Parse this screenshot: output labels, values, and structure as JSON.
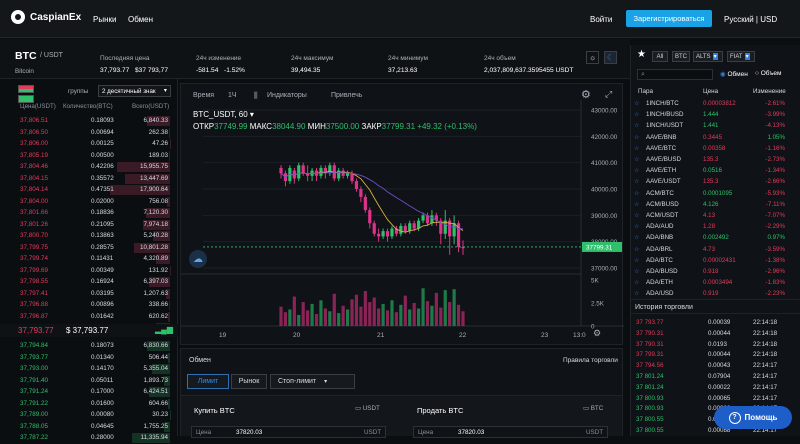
{
  "nav": {
    "brand": "CaspianEx",
    "markets": "Рынки",
    "exchange": "Обмен",
    "login": "Войти",
    "register": "Зарегистрироваться",
    "lang": "Русский | USD"
  },
  "ticker": {
    "pair": "BTC",
    "quote": "/ USDT",
    "name": "Bitcoin",
    "last_price_label": "Последняя цена",
    "last_price": "37,793.77",
    "last_price_usd": "$37 793,77",
    "change_label": "24ч изменение",
    "change": "-581.54",
    "change_pct": "-1.52%",
    "high_label": "24ч максимум",
    "high": "39,494.35",
    "low_label": "24ч минимум",
    "low": "37,213.63",
    "volume_label": "24ч объем",
    "volume": "2,037,809,637.3595455 USDT"
  },
  "orderbook": {
    "groups_label": "группы",
    "decimals": "2 десятичный знак",
    "col_price": "Цена(USDT)",
    "col_qty": "Количество(BTC)",
    "col_total": "Всего(USDT)",
    "asks": [
      [
        "37,806.51",
        "0.18093",
        "6,840.33"
      ],
      [
        "37,806.50",
        "0.00694",
        "262.38"
      ],
      [
        "37,806.00",
        "0.00125",
        "47.26"
      ],
      [
        "37,805.19",
        "0.00500",
        "189.03"
      ],
      [
        "37,804.46",
        "0.42206",
        "15,955.75"
      ],
      [
        "37,804.15",
        "0.35572",
        "13,447.69"
      ],
      [
        "37,804.14",
        "0.47351",
        "17,900.64"
      ],
      [
        "37,804.00",
        "0.02000",
        "756.08"
      ],
      [
        "37,801.66",
        "0.18836",
        "7,120.30"
      ],
      [
        "37,801.26",
        "0.21095",
        "7,974.18"
      ],
      [
        "37,800.70",
        "0.13863",
        "5,240.28"
      ],
      [
        "37,799.75",
        "0.28575",
        "10,801.28"
      ],
      [
        "37,799.74",
        "0.11431",
        "4,320.89"
      ],
      [
        "37,799.69",
        "0.00349",
        "131.92"
      ],
      [
        "37,798.55",
        "0.16924",
        "6,397.03"
      ],
      [
        "37,797.41",
        "0.03195",
        "1,207.63"
      ],
      [
        "37,796.88",
        "0.00896",
        "338.66"
      ],
      [
        "37,796.87",
        "0.01642",
        "620.62"
      ],
      [
        "37,794.85",
        "0.11013",
        "4,162.55"
      ]
    ],
    "mid_price": "37,793.77",
    "mid_usd": "$ 37,793.77",
    "bids": [
      [
        "37,794.84",
        "0.18073",
        "6,830.66"
      ],
      [
        "37,793.77",
        "0.01340",
        "506.44"
      ],
      [
        "37,793.00",
        "0.14170",
        "5,355.04"
      ],
      [
        "37,791.40",
        "0.05011",
        "1,893.73"
      ],
      [
        "37,791.24",
        "0.17000",
        "6,424.51"
      ],
      [
        "37,791.22",
        "0.01600",
        "604.66"
      ],
      [
        "37,789.00",
        "0.00080",
        "30.23"
      ],
      [
        "37,788.05",
        "0.04645",
        "1,755.25"
      ],
      [
        "37,787.22",
        "0.28000",
        "11,335.94"
      ]
    ]
  },
  "chart": {
    "tab_time": "Время",
    "tab_interval": "1Ч",
    "tab_indicators": "Индикаторы",
    "tab_recent": "Привлечь",
    "title": "BTC_USDT, 60",
    "ohlc": "ОТКР37749.99 МАКС38044.90 МИН37500.00 ЗАКР37799.31 +49.32 (+0.13%)",
    "open": "37749.99",
    "high": "38044.90",
    "low": "37500.00",
    "close": "37799.31",
    "change": "+49.32 (+0.13%)",
    "price_ticks": [
      "43000.00",
      "42000.00",
      "41000.00",
      "40000.00",
      "39000.00",
      "38000.00",
      "37000.00"
    ],
    "current_tag": "37799.31",
    "vol_ticks": [
      "5K",
      "2.5K",
      "0"
    ],
    "x_ticks": [
      "19",
      "20",
      "21",
      "22",
      "23",
      "13:0"
    ]
  },
  "chart_data": {
    "type": "candlestick",
    "x_ticks": [
      "19",
      "20",
      "21",
      "22",
      "23"
    ],
    "ylim": [
      37000,
      43000
    ],
    "last": 37799.31,
    "candles": [
      [
        40800,
        40600,
        40900,
        40400
      ],
      [
        40600,
        40300,
        40700,
        40100
      ],
      [
        40300,
        40800,
        40900,
        40200
      ],
      [
        40700,
        40400,
        40800,
        40200
      ],
      [
        40400,
        40900,
        41000,
        40300
      ],
      [
        40900,
        40600,
        41000,
        40500
      ],
      [
        40600,
        40500,
        40900,
        40300
      ],
      [
        40500,
        40700,
        40800,
        40300
      ],
      [
        40700,
        40500,
        40800,
        40300
      ],
      [
        40500,
        40800,
        40900,
        40400
      ],
      [
        40800,
        40600,
        40900,
        40400
      ],
      [
        40600,
        40900,
        41000,
        40500
      ],
      [
        40900,
        40400,
        41000,
        40300
      ],
      [
        40400,
        40700,
        40800,
        40300
      ],
      [
        40700,
        40500,
        40800,
        40400
      ],
      [
        40500,
        40600,
        40700,
        40400
      ],
      [
        40600,
        40300,
        40700,
        40200
      ],
      [
        40300,
        40000,
        40400,
        39900
      ],
      [
        40000,
        39700,
        40100,
        39500
      ],
      [
        39700,
        39200,
        39800,
        39100
      ],
      [
        39200,
        38700,
        39300,
        38500
      ],
      [
        38700,
        38300,
        38800,
        38200
      ],
      [
        38300,
        38200,
        38500,
        38000
      ],
      [
        38200,
        38400,
        38500,
        38100
      ],
      [
        38400,
        38200,
        38500,
        38000
      ],
      [
        38200,
        38500,
        38600,
        38100
      ],
      [
        38500,
        38300,
        38600,
        38200
      ],
      [
        38300,
        38600,
        38700,
        38200
      ],
      [
        38600,
        38400,
        38700,
        38300
      ],
      [
        38400,
        38700,
        38800,
        38300
      ],
      [
        38700,
        38500,
        38800,
        38400
      ],
      [
        38500,
        38800,
        38900,
        38400
      ],
      [
        38800,
        39000,
        39100,
        38700
      ],
      [
        39000,
        38700,
        39100,
        38600
      ],
      [
        38700,
        39000,
        39200,
        38600
      ],
      [
        39000,
        38800,
        39100,
        38600
      ],
      [
        38800,
        38300,
        38900,
        37900
      ],
      [
        38300,
        38800,
        39200,
        38100
      ],
      [
        38800,
        38200,
        38900,
        37500
      ],
      [
        38200,
        38700,
        39000,
        37900
      ],
      [
        38700,
        37800,
        38800,
        37600
      ],
      [
        37800,
        37750,
        38050,
        37500
      ]
    ],
    "volumes": [
      2.1,
      1.5,
      1.8,
      3.2,
      1.2,
      2.6,
      1.7,
      2.4,
      1.3,
      2.8,
      1.9,
      1.6,
      3.5,
      1.4,
      2.2,
      1.8,
      2.9,
      3.4,
      2.1,
      3.8,
      2.6,
      3.1,
      1.9,
      2.4,
      1.7,
      2.8,
      1.5,
      2.3,
      3.3,
      1.8,
      2.5,
      1.9,
      4.1,
      2.7,
      2.2,
      3.6,
      2.0,
      3.9,
      2.6,
      4.0,
      2.3,
      1.6
    ],
    "vol_ylim": [
      0,
      5
    ]
  },
  "trade": {
    "title": "Обмен",
    "rules": "Правила торговли",
    "tab_limit": "Лимит",
    "tab_market": "Рынок",
    "tab_stoplimit": "Стоп-лимит",
    "buy_title": "Купить BTC",
    "sell_title": "Продать BTC",
    "balance_unit_buy": "USDT",
    "balance_unit_sell": "BTC",
    "price_label": "Цена",
    "buy_price": "37820.03",
    "sell_price": "37820.03",
    "price_unit": "USDT"
  },
  "markets": {
    "tabs": [
      "All",
      "BTC",
      "ALTS",
      "FIAT"
    ],
    "radio_exchange": "Обмен",
    "radio_volume": "Объем",
    "search_placeholder": "",
    "col_pair": "Пара",
    "col_price": "Цена",
    "col_change": "Изменение",
    "rows": [
      [
        "1INCH/BTC",
        "0.00003812",
        "-2.61%",
        "red"
      ],
      [
        "1INCH/BUSD",
        "1.444",
        "-3.99%",
        "green"
      ],
      [
        "1INCH/USDT",
        "1.441",
        "-4.13%",
        "green"
      ],
      [
        "AAVE/BNB",
        "0.3445",
        "1.05%",
        "red"
      ],
      [
        "AAVE/BTC",
        "0.00358",
        "-1.16%",
        "red"
      ],
      [
        "AAVE/BUSD",
        "135.3",
        "-2.73%",
        "red"
      ],
      [
        "AAVE/ETH",
        "0.0516",
        "-1.34%",
        "green"
      ],
      [
        "AAVE/USDT",
        "135.3",
        "-2.66%",
        "red"
      ],
      [
        "ACM/BTC",
        "0.0001095",
        "-5.93%",
        "green"
      ],
      [
        "ACM/BUSD",
        "4.126",
        "-7.11%",
        "green"
      ],
      [
        "ACM/USDT",
        "4.13",
        "-7.07%",
        "red"
      ],
      [
        "ADA/AUD",
        "1.28",
        "-2.29%",
        "red"
      ],
      [
        "ADA/BNB",
        "0.002492",
        "0.97%",
        "green"
      ],
      [
        "ADA/BRL",
        "4.73",
        "-3.59%",
        "red"
      ],
      [
        "ADA/BTC",
        "0.00002431",
        "-1.38%",
        "red"
      ],
      [
        "ADA/BUSD",
        "0.918",
        "-2.96%",
        "red"
      ],
      [
        "ADA/ETH",
        "0.0003494",
        "-1.83%",
        "red"
      ],
      [
        "ADA/USD",
        "0.919",
        "-2.23%",
        "red"
      ]
    ]
  },
  "trades": {
    "title": "История торговли",
    "rows": [
      [
        "37 793.77",
        "0.00039",
        "22:14:18",
        "red"
      ],
      [
        "37 790.31",
        "0.00044",
        "22:14:18",
        "red"
      ],
      [
        "37 790.31",
        "0.0193",
        "22:14:18",
        "red"
      ],
      [
        "37 799.31",
        "0.00044",
        "22:14:18",
        "red"
      ],
      [
        "37 794.56",
        "0.00043",
        "22:14:17",
        "red"
      ],
      [
        "37 801.24",
        "0.07904",
        "22:14:17",
        "green"
      ],
      [
        "37 801.24",
        "0.00022",
        "22:14:17",
        "green"
      ],
      [
        "37 800.93",
        "0.00065",
        "22:14:17",
        "green"
      ],
      [
        "37 800.93",
        "0.00088",
        "22:14:17",
        "green"
      ],
      [
        "37 800.55",
        "0.00083",
        "22:14:17",
        "green"
      ],
      [
        "37 800.55",
        "0.00088",
        "22:14:17",
        "green"
      ]
    ]
  },
  "help": "Помощь"
}
